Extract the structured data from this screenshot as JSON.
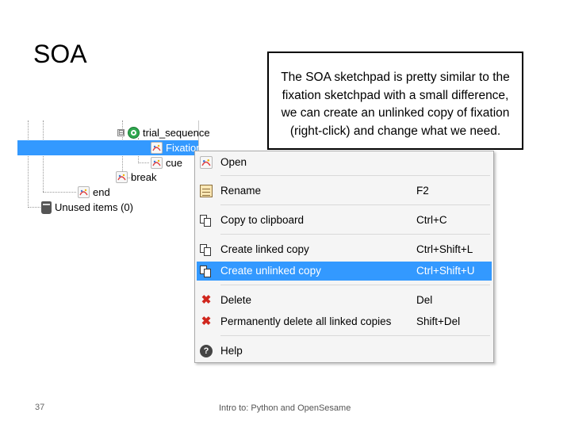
{
  "slide": {
    "title": "SOA",
    "callout": "The SOA sketchpad is pretty similar to the fixation sketchpad with a small difference, we can create an unlinked copy of fixation (right-click) and change what we need.",
    "page_number": "37",
    "footer": "Intro to: Python and OpenSesame"
  },
  "tree": {
    "items": [
      {
        "label": "trial_sequence",
        "icon": "sequence-icon",
        "expander": "⊟"
      },
      {
        "label": "Fixation",
        "icon": "sketchpad-icon",
        "selected": true
      },
      {
        "label": "cue",
        "icon": "sketchpad-icon"
      },
      {
        "label": "break",
        "icon": "sketchpad-icon"
      },
      {
        "label": "end",
        "icon": "sketchpad-icon"
      },
      {
        "label": "Unused items (0)",
        "icon": "trash-icon"
      }
    ]
  },
  "context_menu": {
    "items": [
      {
        "label": "Open",
        "shortcut": "",
        "icon": "sketchpad-icon"
      },
      {
        "label": "Rename",
        "shortcut": "F2",
        "icon": "rename-icon"
      },
      {
        "label": "Copy to clipboard",
        "shortcut": "Ctrl+C",
        "icon": "copy-icon"
      },
      {
        "label": "Create linked copy",
        "shortcut": "Ctrl+Shift+L",
        "icon": "copy-icon"
      },
      {
        "label": "Create unlinked copy",
        "shortcut": "Ctrl+Shift+U",
        "icon": "copy-icon",
        "highlighted": true
      },
      {
        "label": "Delete",
        "shortcut": "Del",
        "icon": "delete-icon"
      },
      {
        "label": "Permanently delete all linked copies",
        "shortcut": "Shift+Del",
        "icon": "delete-icon"
      },
      {
        "label": "Help",
        "shortcut": "",
        "icon": "help-icon"
      }
    ]
  },
  "colors": {
    "selection": "#3399ff",
    "menu_background": "#f5f5f5",
    "delete_icon": "#d0261d"
  }
}
